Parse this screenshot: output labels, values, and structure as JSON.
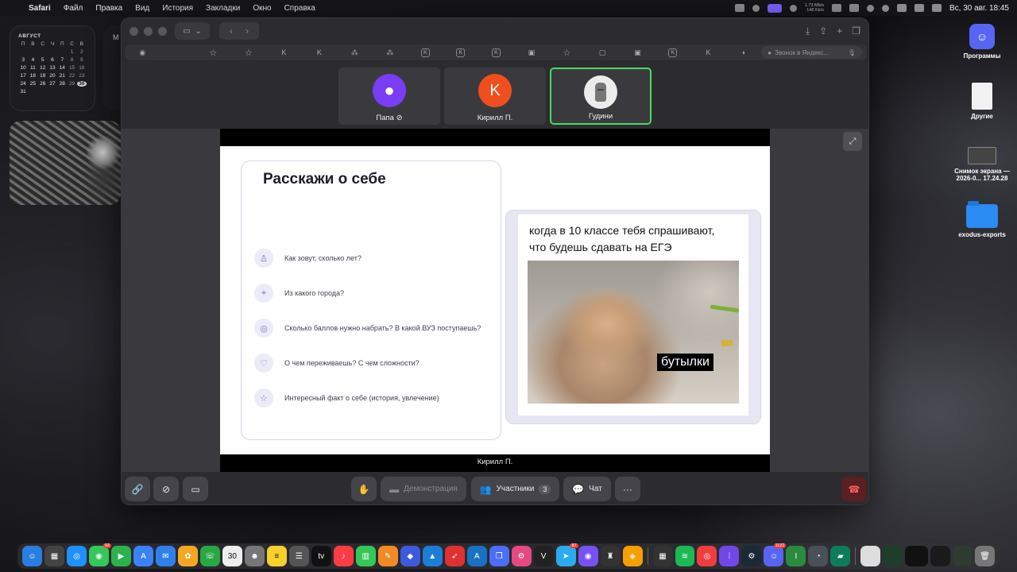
{
  "menubar": {
    "app": "Safari",
    "items": [
      "Файл",
      "Правка",
      "Вид",
      "История",
      "Закладки",
      "Окно",
      "Справка"
    ],
    "net_speed_up": "1.73 Mb/s",
    "net_speed_down": "148 Kb/s",
    "datetime": "Вс, 30 авг.  18:45"
  },
  "calendar": {
    "month": "АВГУСТ",
    "weekdays": [
      "П",
      "В",
      "С",
      "Ч",
      "П",
      "С",
      "В"
    ],
    "days": [
      "",
      "",
      "",
      "",
      "",
      "1",
      "2",
      "3",
      "4",
      "5",
      "6",
      "7",
      "8",
      "9",
      "10",
      "11",
      "12",
      "13",
      "14",
      "15",
      "16",
      "17",
      "18",
      "19",
      "20",
      "21",
      "22",
      "23",
      "24",
      "25",
      "26",
      "27",
      "28",
      "29",
      "30",
      "31"
    ],
    "today": "30",
    "second_widget_letter": "М"
  },
  "safari": {
    "search_placeholder": "Звонок в Яндекс...",
    "favorites": [
      "K",
      "K",
      "K",
      "K",
      "K",
      "K"
    ]
  },
  "call": {
    "participants": [
      {
        "name": "Папа",
        "muted": true,
        "initial": ""
      },
      {
        "name": "Кирилл П.",
        "initial": "K"
      },
      {
        "name": "Гудини",
        "active": true
      }
    ],
    "presenter_label": "Кирилл П.",
    "controls": {
      "raise_hand": "✋",
      "demo_label": "Демонстрация",
      "participants_label": "Участники",
      "participants_count": "3",
      "chat_label": "Чат",
      "more": "···"
    }
  },
  "slide": {
    "title": "Расскажи о себе",
    "questions": [
      "Как зовут, сколько лет?",
      "Из какого города?",
      "Сколько баллов нужно набрать? В какой ВУЗ поступаешь?",
      "О чем переживаешь? С чем сложности?",
      "Интересный факт о себе (история, увлечение)"
    ],
    "meme_line1": "когда в 10 классе тебя спрашивают,",
    "meme_line2": "что будешь сдавать на ЕГЭ",
    "meme_caption": "бутылки"
  },
  "desktop": {
    "icons": [
      {
        "label": "Программы"
      },
      {
        "label": "Другие"
      },
      {
        "label": "Снимок экрана —",
        "label2": "2026-0... 17.24.28"
      },
      {
        "label": "exodus-exports"
      }
    ]
  },
  "dock": {
    "badges": {
      "messages": "93",
      "calendar_day": "30",
      "telegram": "87",
      "app_badge": "1122"
    }
  }
}
